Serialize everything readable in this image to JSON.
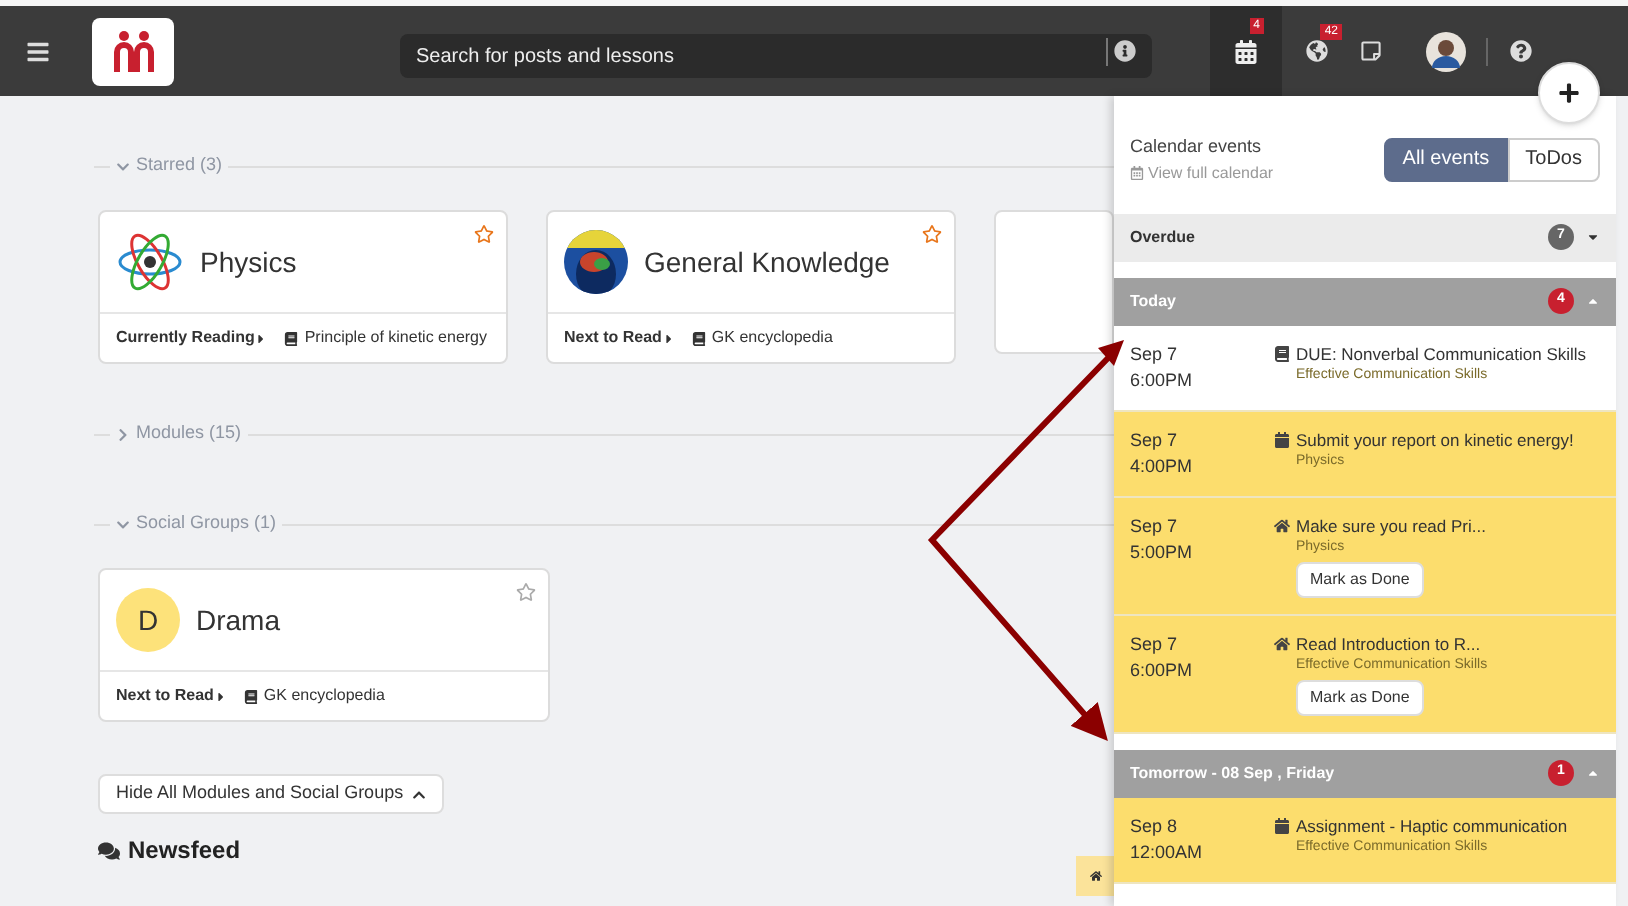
{
  "topbar": {
    "search": {
      "placeholder": "Search for posts and lessons"
    },
    "calendar_badge": "4",
    "notifications_badge": "42"
  },
  "sections": [
    {
      "title": "Starred (3)",
      "expanded": true,
      "cards": [
        {
          "title": "Physics",
          "kind": "atom",
          "starred": true,
          "status": "Currently Reading",
          "item": "Principle of kinetic energy"
        },
        {
          "title": "General Knowledge",
          "kind": "picture",
          "starred": true,
          "status": "Next to Read",
          "item": "GK encyclopedia"
        }
      ]
    },
    {
      "title": "Modules (15)",
      "expanded": false
    },
    {
      "title": "Social Groups (1)",
      "expanded": true,
      "cards": [
        {
          "title": "Drama",
          "kind": "initial",
          "initial": "D",
          "starred": false,
          "status": "Next to Read",
          "item": "GK encyclopedia"
        }
      ]
    }
  ],
  "hide_button": "Hide All Modules and Social Groups",
  "newsfeed": {
    "title": "Newsfeed"
  },
  "calendar_panel": {
    "title": "Calendar events",
    "link": "View full calendar",
    "tabs": [
      {
        "label": "All events",
        "selected": true
      },
      {
        "label": "ToDos",
        "selected": false
      }
    ],
    "groups": [
      {
        "title": "Overdue",
        "count": "7",
        "expanded": false
      },
      {
        "title": "Today",
        "count": "4",
        "expanded": true,
        "events": [
          {
            "kind": "reading",
            "date": "Sep 7",
            "time": "6:00PM",
            "title": "DUE: Nonverbal Communication Skills",
            "course": "Effective Communication Skills"
          },
          {
            "kind": "assignment",
            "date": "Sep 7",
            "time": "4:00PM",
            "title": "Submit your report on kinetic energy!",
            "course": "Physics"
          },
          {
            "kind": "todo",
            "date": "Sep 7",
            "time": "5:00PM",
            "title": "Make sure you read Pri...",
            "course": "Physics",
            "button": "Mark as Done"
          },
          {
            "kind": "todo",
            "date": "Sep 7",
            "time": "6:00PM",
            "title": "Read Introduction to R...",
            "course": "Effective Communication Skills",
            "button": "Mark as Done"
          }
        ]
      },
      {
        "title": "Tomorrow - 08 Sep , Friday",
        "count": "1",
        "expanded": true,
        "events": [
          {
            "kind": "assignment",
            "date": "Sep 8",
            "time": "12:00AM",
            "title": "Assignment - Haptic communication",
            "course": "Effective Communication Skills"
          }
        ]
      }
    ]
  }
}
